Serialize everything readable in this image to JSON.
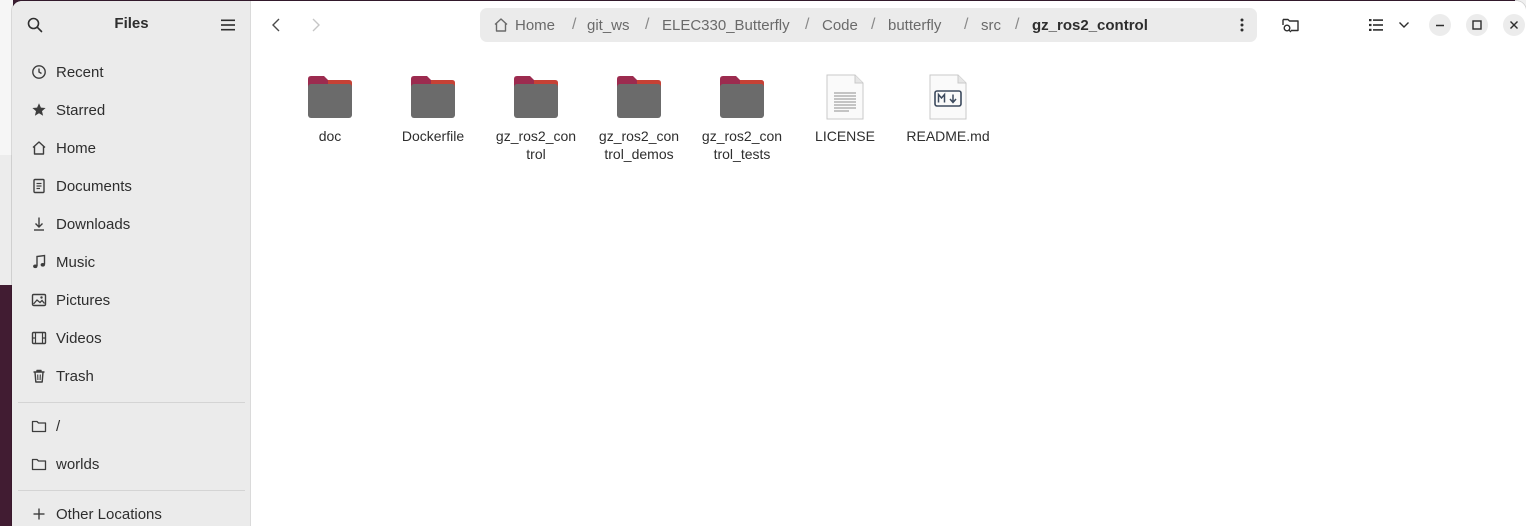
{
  "sidebar": {
    "title": "Files",
    "places": [
      {
        "label": "Recent",
        "icon": "clock-icon"
      },
      {
        "label": "Starred",
        "icon": "star-icon"
      },
      {
        "label": "Home",
        "icon": "home-icon"
      },
      {
        "label": "Documents",
        "icon": "document-icon"
      },
      {
        "label": "Downloads",
        "icon": "download-icon"
      },
      {
        "label": "Music",
        "icon": "music-icon"
      },
      {
        "label": "Pictures",
        "icon": "picture-icon"
      },
      {
        "label": "Videos",
        "icon": "video-icon"
      },
      {
        "label": "Trash",
        "icon": "trash-icon"
      }
    ],
    "bookmarks": [
      {
        "label": "/",
        "icon": "folder-icon"
      },
      {
        "label": "worlds",
        "icon": "folder-icon"
      }
    ],
    "other_locations": {
      "label": "Other Locations",
      "icon": "plus-icon"
    }
  },
  "pathbar": {
    "crumbs": [
      "Home",
      "git_ws",
      "ELEC330_Butterfly",
      "Code",
      "butterfly",
      "src",
      "gz_ros2_control"
    ],
    "separator": "/"
  },
  "files": [
    {
      "name": "doc",
      "kind": "folder"
    },
    {
      "name": "Dockerfile",
      "kind": "folder"
    },
    {
      "name": "gz_ros2_control",
      "kind": "folder",
      "wrapped": [
        "gz_ros2_con",
        "trol"
      ]
    },
    {
      "name": "gz_ros2_control_demos",
      "kind": "folder",
      "wrapped": [
        "gz_ros2_con",
        "trol_demos"
      ]
    },
    {
      "name": "gz_ros2_control_tests",
      "kind": "folder",
      "wrapped": [
        "gz_ros2_con",
        "trol_tests"
      ]
    },
    {
      "name": "LICENSE",
      "kind": "text"
    },
    {
      "name": "README.md",
      "kind": "markdown"
    }
  ],
  "colors": {
    "folder_body": "#6b6b6b",
    "folder_tab": "#9c2b4f",
    "folder_accent": "#e95420",
    "sidebar_bg": "#ebebeb"
  }
}
